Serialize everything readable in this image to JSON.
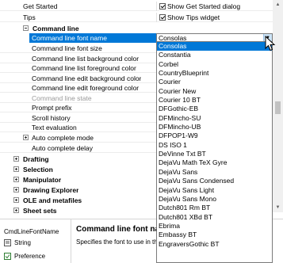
{
  "top_rows": [
    {
      "name": "Get Started",
      "value": "Show Get Started dialog"
    },
    {
      "name": "Tips",
      "value": "Show Tips widget"
    }
  ],
  "command_line": {
    "header": "Command line",
    "rows": [
      "Command line font name",
      "Command line font size",
      "Command line list background color",
      "Command line list foreground color",
      "Command line edit background color",
      "Command line edit foreground color",
      "Command line state",
      "Prompt prefix",
      "Scroll history",
      "Text evaluation",
      "Auto complete mode",
      "Auto complete delay"
    ],
    "selected_value": "Consolas"
  },
  "categories": [
    "Drafting",
    "Selection",
    "Manipulator",
    "Drawing Explorer",
    "OLE and metafiles",
    "Sheet sets"
  ],
  "font_options": [
    "Consolas",
    "Constantia",
    "Corbel",
    "CountryBlueprint",
    "Courier",
    "Courier New",
    "Courier 10 BT",
    "DFGothic-EB",
    "DFMincho-SU",
    "DFMincho-UB",
    "DFPOP1-W9",
    "DS ISO 1",
    "DeVinne Txt BT",
    "DejaVu Math TeX Gyre",
    "DejaVu Sans",
    "DejaVu Sans Condensed",
    "DejaVu Sans Light",
    "DejaVu Sans Mono",
    "Dutch801 Rm BT",
    "Dutch801 XBd BT",
    "Ebrima",
    "Embassy BT",
    "EngraversGothic BT"
  ],
  "description": {
    "property_id": "CmdLineFontName",
    "type": "String",
    "source": "Preference",
    "title": "Command line font nan",
    "text": "Specifies the font to use in the"
  },
  "colors": {
    "selection": "#0078d7",
    "disabled_text": "#9a9a9a"
  }
}
